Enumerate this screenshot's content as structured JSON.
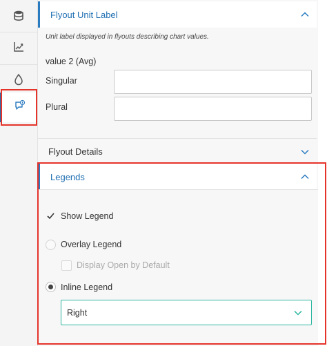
{
  "rail": {
    "items": [
      {
        "icon": "database-icon"
      },
      {
        "icon": "chart-axis-icon"
      },
      {
        "icon": "drop-icon"
      },
      {
        "icon": "comment-info-icon"
      }
    ]
  },
  "flyout_unit": {
    "title": "Flyout Unit Label",
    "hint": "Unit label displayed in flyouts describing chart values.",
    "group_label": "value 2 (Avg)",
    "singular_label": "Singular",
    "singular_value": "",
    "plural_label": "Plural",
    "plural_value": ""
  },
  "flyout_details": {
    "title": "Flyout Details"
  },
  "legends": {
    "title": "Legends",
    "show_legend_label": "Show Legend",
    "show_legend_checked": true,
    "overlay_label": "Overlay Legend",
    "display_open_label": "Display Open by Default",
    "inline_label": "Inline Legend",
    "position_value": "Right"
  },
  "colors": {
    "accent_blue": "#1f6fb2",
    "highlight_red": "#e5332a",
    "select_border": "#2bb5a0"
  }
}
